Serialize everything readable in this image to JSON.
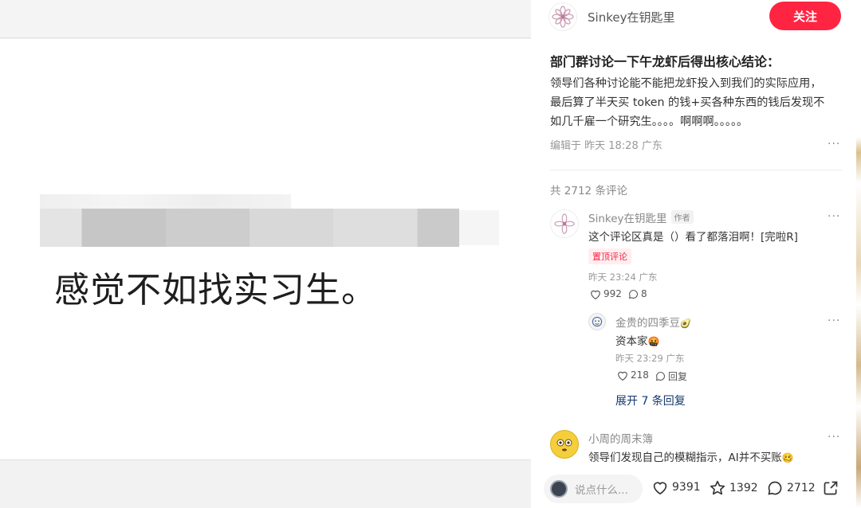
{
  "image_panel": {
    "caption": "感觉不如找实习生。"
  },
  "post": {
    "author_name": "Sinkey在钥匙里",
    "follow_label": "关注",
    "title": "部门群讨论一下午龙虾后得出核心结论：",
    "body_line1": "领导们各种讨论能不能把龙虾投入到我们的实际应用，",
    "body_line2": "最后算了半天买 token 的钱+买各种东西的钱后发现不",
    "body_line3": "如几千雇一个研究生。。。。啊啊啊。。。。。",
    "meta": "编辑于 昨天 18:28 广东",
    "more": "···"
  },
  "comments": {
    "count_label": "共 2712 条评论",
    "items": [
      {
        "name": "Sinkey在钥匙里",
        "author_tag": "作者",
        "text": "这个评论区真是（）看了都落泪啊！[完啦R]",
        "pinned_tag": "置顶评论",
        "time": "昨天 23:24 广东",
        "likes": "992",
        "replies": "8"
      },
      {
        "name": "金贵的四季豆",
        "name_emoji": "🥑",
        "text": "资本家",
        "text_emoji": "🤬",
        "time": "昨天 23:29 广东",
        "likes": "218",
        "reply_label": "回复"
      },
      {
        "name": "小周的周末簿",
        "text": "领导们发现自己的模糊指示，AI并不买账",
        "text_emoji": "🥴"
      }
    ],
    "expand_label": "展开 7 条回复"
  },
  "bottom_bar": {
    "input_placeholder": "说点什么...",
    "likes": "9391",
    "stars": "1392",
    "comments": "2712"
  },
  "colors": {
    "accent": "#ff2442",
    "link": "#13386c",
    "muted": "#999999"
  }
}
